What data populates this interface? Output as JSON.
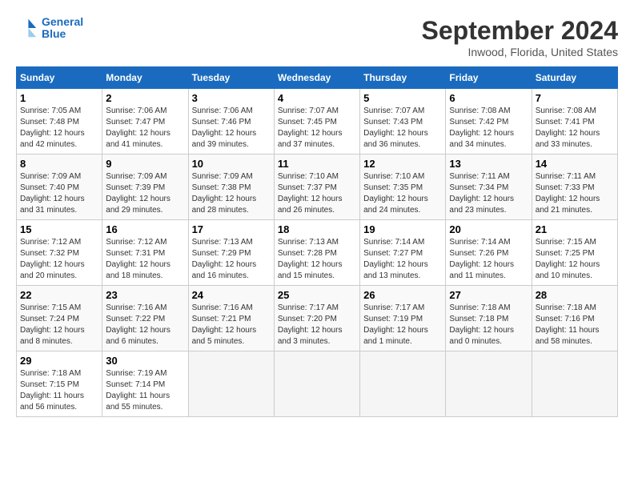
{
  "logo": {
    "line1": "General",
    "line2": "Blue"
  },
  "title": "September 2024",
  "location": "Inwood, Florida, United States",
  "headers": [
    "Sunday",
    "Monday",
    "Tuesday",
    "Wednesday",
    "Thursday",
    "Friday",
    "Saturday"
  ],
  "weeks": [
    [
      {
        "day": "1",
        "info": "Sunrise: 7:05 AM\nSunset: 7:48 PM\nDaylight: 12 hours\nand 42 minutes."
      },
      {
        "day": "2",
        "info": "Sunrise: 7:06 AM\nSunset: 7:47 PM\nDaylight: 12 hours\nand 41 minutes."
      },
      {
        "day": "3",
        "info": "Sunrise: 7:06 AM\nSunset: 7:46 PM\nDaylight: 12 hours\nand 39 minutes."
      },
      {
        "day": "4",
        "info": "Sunrise: 7:07 AM\nSunset: 7:45 PM\nDaylight: 12 hours\nand 37 minutes."
      },
      {
        "day": "5",
        "info": "Sunrise: 7:07 AM\nSunset: 7:43 PM\nDaylight: 12 hours\nand 36 minutes."
      },
      {
        "day": "6",
        "info": "Sunrise: 7:08 AM\nSunset: 7:42 PM\nDaylight: 12 hours\nand 34 minutes."
      },
      {
        "day": "7",
        "info": "Sunrise: 7:08 AM\nSunset: 7:41 PM\nDaylight: 12 hours\nand 33 minutes."
      }
    ],
    [
      {
        "day": "8",
        "info": "Sunrise: 7:09 AM\nSunset: 7:40 PM\nDaylight: 12 hours\nand 31 minutes."
      },
      {
        "day": "9",
        "info": "Sunrise: 7:09 AM\nSunset: 7:39 PM\nDaylight: 12 hours\nand 29 minutes."
      },
      {
        "day": "10",
        "info": "Sunrise: 7:09 AM\nSunset: 7:38 PM\nDaylight: 12 hours\nand 28 minutes."
      },
      {
        "day": "11",
        "info": "Sunrise: 7:10 AM\nSunset: 7:37 PM\nDaylight: 12 hours\nand 26 minutes."
      },
      {
        "day": "12",
        "info": "Sunrise: 7:10 AM\nSunset: 7:35 PM\nDaylight: 12 hours\nand 24 minutes."
      },
      {
        "day": "13",
        "info": "Sunrise: 7:11 AM\nSunset: 7:34 PM\nDaylight: 12 hours\nand 23 minutes."
      },
      {
        "day": "14",
        "info": "Sunrise: 7:11 AM\nSunset: 7:33 PM\nDaylight: 12 hours\nand 21 minutes."
      }
    ],
    [
      {
        "day": "15",
        "info": "Sunrise: 7:12 AM\nSunset: 7:32 PM\nDaylight: 12 hours\nand 20 minutes."
      },
      {
        "day": "16",
        "info": "Sunrise: 7:12 AM\nSunset: 7:31 PM\nDaylight: 12 hours\nand 18 minutes."
      },
      {
        "day": "17",
        "info": "Sunrise: 7:13 AM\nSunset: 7:29 PM\nDaylight: 12 hours\nand 16 minutes."
      },
      {
        "day": "18",
        "info": "Sunrise: 7:13 AM\nSunset: 7:28 PM\nDaylight: 12 hours\nand 15 minutes."
      },
      {
        "day": "19",
        "info": "Sunrise: 7:14 AM\nSunset: 7:27 PM\nDaylight: 12 hours\nand 13 minutes."
      },
      {
        "day": "20",
        "info": "Sunrise: 7:14 AM\nSunset: 7:26 PM\nDaylight: 12 hours\nand 11 minutes."
      },
      {
        "day": "21",
        "info": "Sunrise: 7:15 AM\nSunset: 7:25 PM\nDaylight: 12 hours\nand 10 minutes."
      }
    ],
    [
      {
        "day": "22",
        "info": "Sunrise: 7:15 AM\nSunset: 7:24 PM\nDaylight: 12 hours\nand 8 minutes."
      },
      {
        "day": "23",
        "info": "Sunrise: 7:16 AM\nSunset: 7:22 PM\nDaylight: 12 hours\nand 6 minutes."
      },
      {
        "day": "24",
        "info": "Sunrise: 7:16 AM\nSunset: 7:21 PM\nDaylight: 12 hours\nand 5 minutes."
      },
      {
        "day": "25",
        "info": "Sunrise: 7:17 AM\nSunset: 7:20 PM\nDaylight: 12 hours\nand 3 minutes."
      },
      {
        "day": "26",
        "info": "Sunrise: 7:17 AM\nSunset: 7:19 PM\nDaylight: 12 hours\nand 1 minute."
      },
      {
        "day": "27",
        "info": "Sunrise: 7:18 AM\nSunset: 7:18 PM\nDaylight: 12 hours\nand 0 minutes."
      },
      {
        "day": "28",
        "info": "Sunrise: 7:18 AM\nSunset: 7:16 PM\nDaylight: 11 hours\nand 58 minutes."
      }
    ],
    [
      {
        "day": "29",
        "info": "Sunrise: 7:18 AM\nSunset: 7:15 PM\nDaylight: 11 hours\nand 56 minutes."
      },
      {
        "day": "30",
        "info": "Sunrise: 7:19 AM\nSunset: 7:14 PM\nDaylight: 11 hours\nand 55 minutes."
      },
      {
        "day": "",
        "info": ""
      },
      {
        "day": "",
        "info": ""
      },
      {
        "day": "",
        "info": ""
      },
      {
        "day": "",
        "info": ""
      },
      {
        "day": "",
        "info": ""
      }
    ]
  ]
}
